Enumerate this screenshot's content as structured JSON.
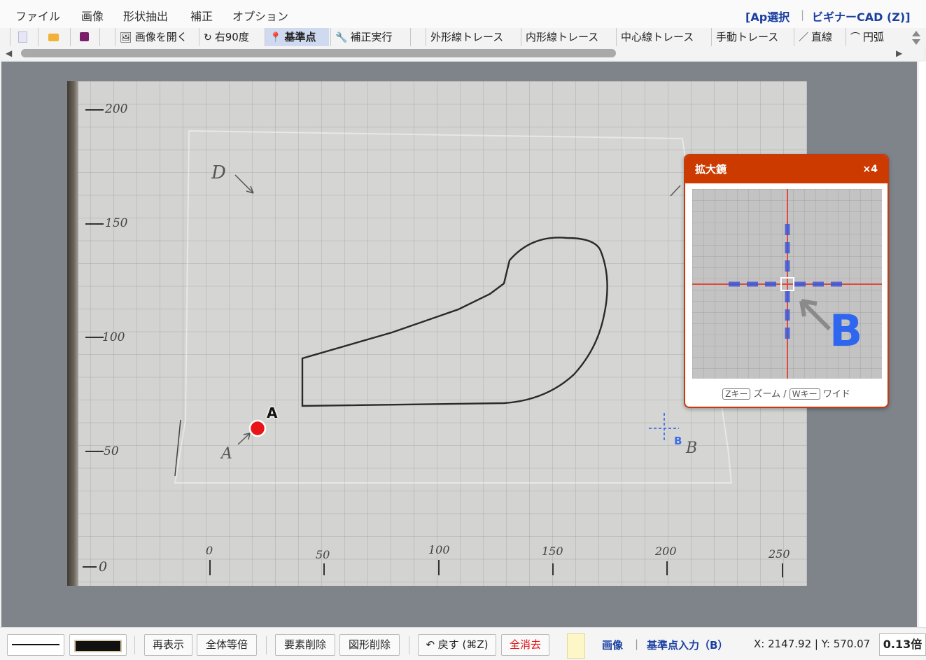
{
  "menu": {
    "items": [
      "ファイル",
      "画像",
      "形状抽出",
      "補正",
      "オプション"
    ],
    "ap_select": "[Ap選択",
    "beginner_cad": "ビギナーCAD (Z)]"
  },
  "toolbar": {
    "open_image": "画像を開く",
    "rotate90": "右90度",
    "reference_point": "基準点",
    "run_correction": "補正実行",
    "outer_trace": "外形線トレース",
    "inner_trace": "内形線トレース",
    "center_trace": "中心線トレース",
    "manual_trace": "手動トレース",
    "line": "直線",
    "arc": "円弧"
  },
  "canvas": {
    "marker_a_label": "A",
    "marker_b_label": "B",
    "ruler_y": [
      "200",
      "150",
      "100",
      "50",
      "0"
    ],
    "ruler_x": [
      "0",
      "50",
      "100",
      "150",
      "200",
      "250"
    ],
    "corner_labels": [
      "D",
      "A",
      "B"
    ]
  },
  "magnifier": {
    "title": "拡大鏡",
    "zoom": "×4",
    "key_z": "Zキー",
    "zoom_label": "ズーム /",
    "key_w": "Wキー",
    "wide_label": "ワイド",
    "glyph": "B"
  },
  "statusbar": {
    "redraw": "再表示",
    "fit_all": "全体等倍",
    "delete_element": "要素削除",
    "delete_shape": "図形削除",
    "undo": "↶ 戻す (⌘Z)",
    "clear_all": "全消去",
    "mode_image": "画像",
    "mode_sep": "|",
    "mode_text": "基準点入力（B）",
    "coords": "X: 2147.92 | Y: 570.07",
    "zoom_level": "0.13倍"
  },
  "colors": {
    "accent": "#1a3fa0",
    "magnifier_header": "#cc3a00",
    "marker_a": "#e8141a",
    "marker_b": "#3b6df0",
    "clear_all_text": "#e01010"
  }
}
